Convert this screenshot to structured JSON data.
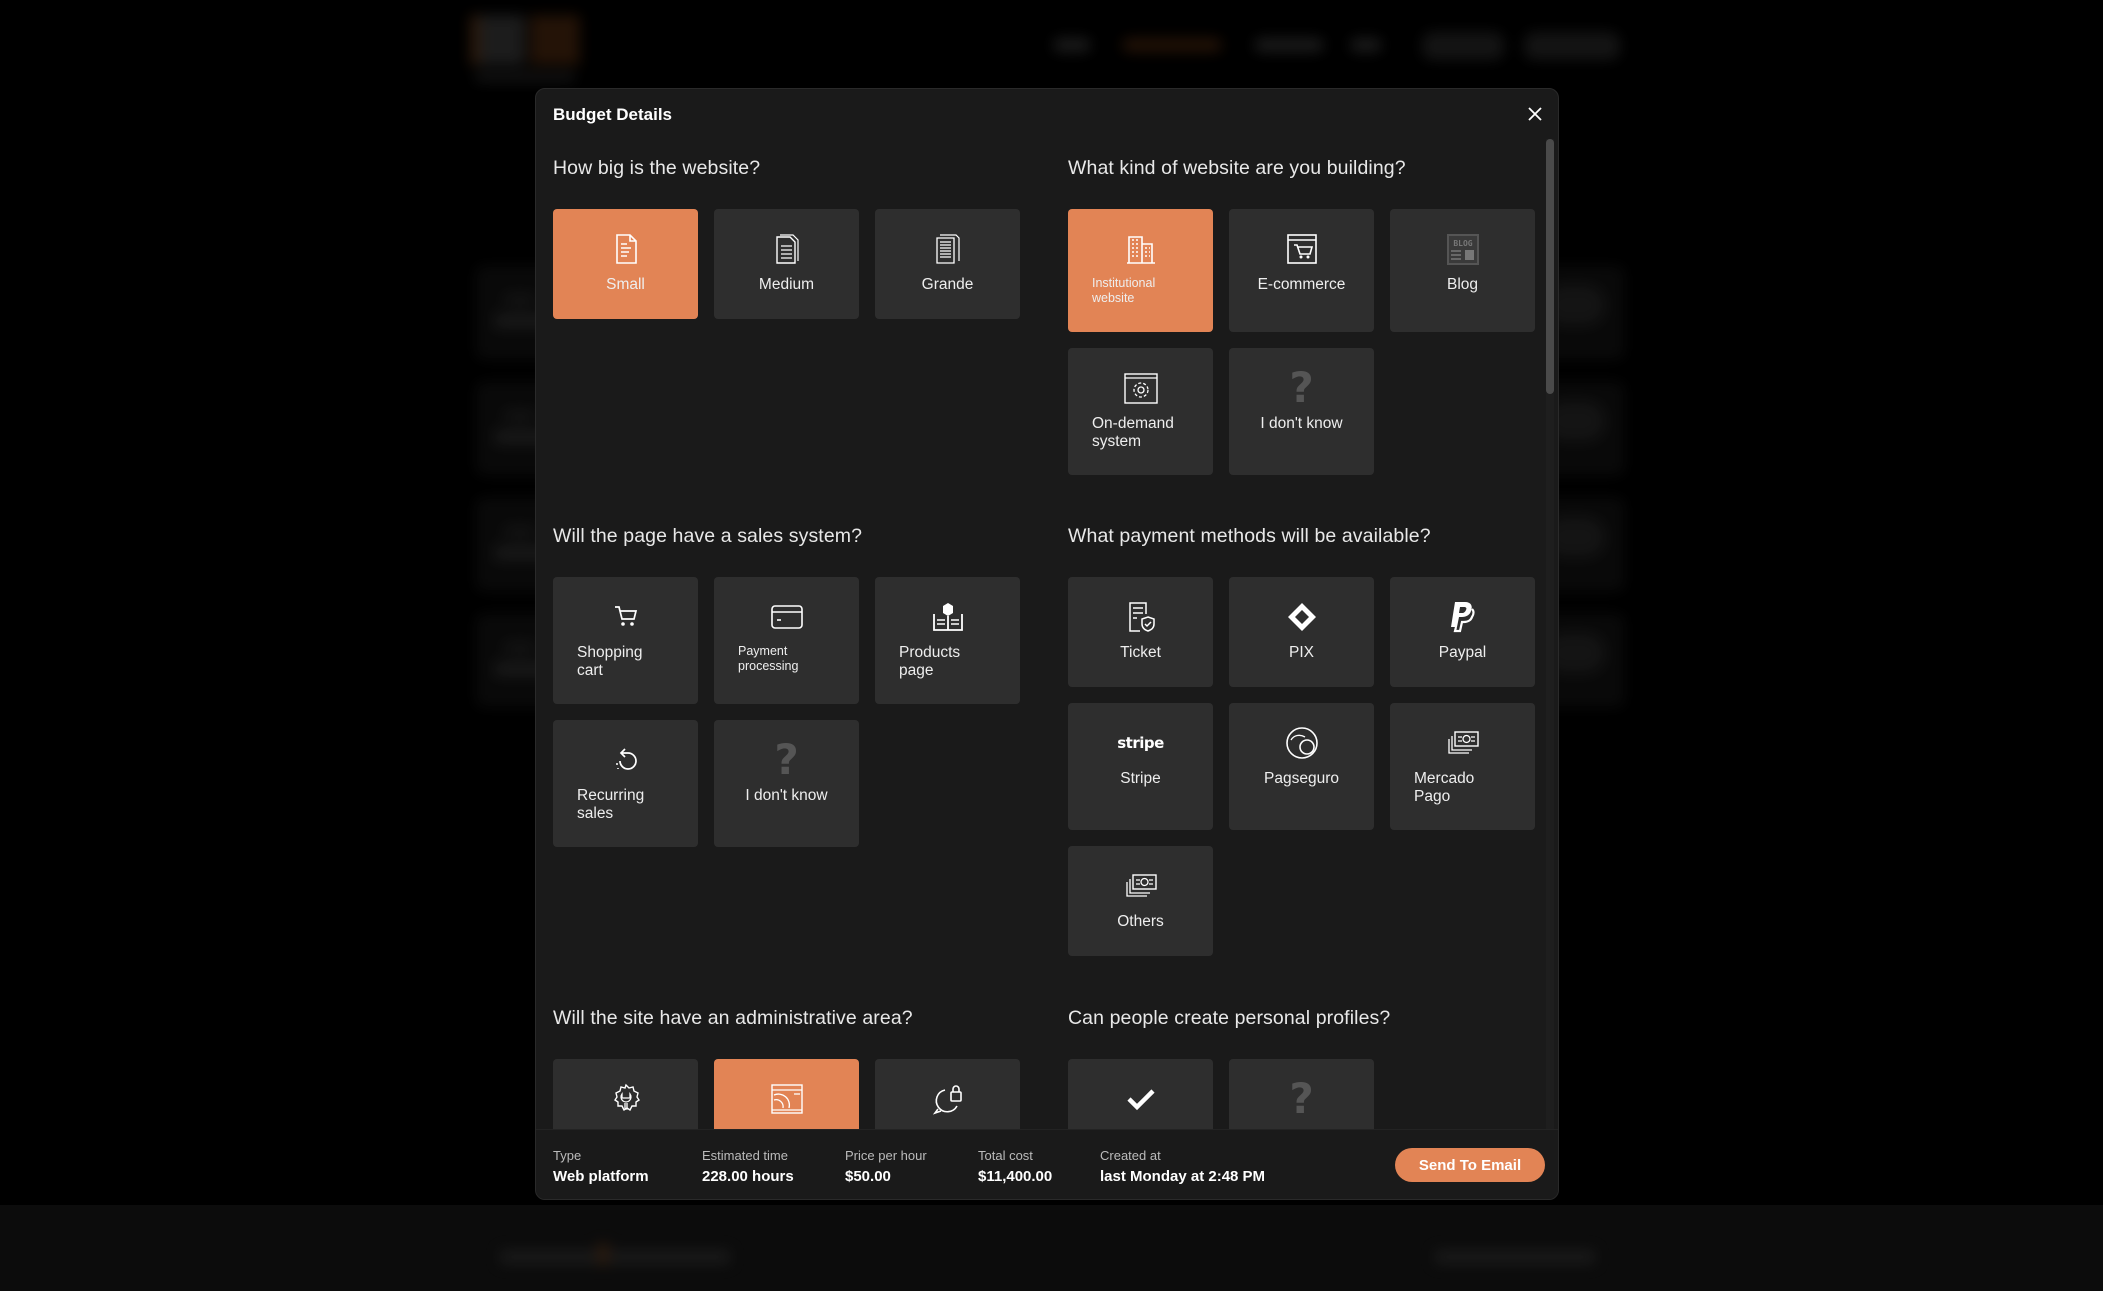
{
  "modal": {
    "title": "Budget Details",
    "close_label": "close"
  },
  "sections": {
    "size": {
      "question": "How big is the website?",
      "options": [
        {
          "label": "Small",
          "icon": "document-icon",
          "selected": true
        },
        {
          "label": "Medium",
          "icon": "documents-icon",
          "selected": false
        },
        {
          "label": "Grande",
          "icon": "document-stack-icon",
          "selected": false
        }
      ]
    },
    "kind": {
      "question": "What kind of website are you building?",
      "options": [
        {
          "label": "Institutional website",
          "icon": "building-icon",
          "selected": true
        },
        {
          "label": "E-commerce",
          "icon": "browser-cart-icon",
          "selected": false
        },
        {
          "label": "Blog",
          "icon": "blog-icon",
          "selected": false,
          "icon_text": "BLOG"
        },
        {
          "label": "On-demand system",
          "icon": "browser-gear-icon",
          "selected": false
        },
        {
          "label": "I don't know",
          "icon": "question-icon",
          "selected": false,
          "icon_text": "?"
        }
      ]
    },
    "sales": {
      "question": "Will the page have a sales system?",
      "options": [
        {
          "label": "Shopping cart",
          "icon": "cart-icon",
          "selected": false
        },
        {
          "label": "Payment processing",
          "icon": "credit-card-icon",
          "selected": false
        },
        {
          "label": "Products page",
          "icon": "product-catalog-icon",
          "selected": false
        },
        {
          "label": "Recurring sales",
          "icon": "recurring-icon",
          "selected": false
        },
        {
          "label": "I don't know",
          "icon": "question-icon",
          "selected": false,
          "icon_text": "?"
        }
      ]
    },
    "payment": {
      "question": "What payment methods will be available?",
      "options": [
        {
          "label": "Ticket",
          "icon": "ticket-shield-icon",
          "selected": false
        },
        {
          "label": "PIX",
          "icon": "pix-icon",
          "selected": false
        },
        {
          "label": "Paypal",
          "icon": "paypal-icon",
          "selected": false
        },
        {
          "label": "Stripe",
          "icon": "stripe-icon",
          "selected": false,
          "icon_text": "stripe"
        },
        {
          "label": "Pagseguro",
          "icon": "pagseguro-icon",
          "selected": false
        },
        {
          "label": "Mercado Pago",
          "icon": "banknotes-icon",
          "selected": false
        },
        {
          "label": "Others",
          "icon": "banknotes-icon",
          "selected": false
        }
      ]
    },
    "admin": {
      "question": "Will the site have an administrative area?",
      "options": [
        {
          "icon": "gear-wrench-icon",
          "selected": false
        },
        {
          "icon": "browser-admin-icon",
          "selected": true
        },
        {
          "icon": "chat-lock-icon",
          "selected": false
        }
      ]
    },
    "profiles": {
      "question": "Can people create personal profiles?",
      "options": [
        {
          "icon": "check-icon",
          "selected": false
        },
        {
          "icon": "question-icon",
          "selected": false,
          "icon_text": "?"
        }
      ]
    }
  },
  "summary": {
    "type_label": "Type",
    "type_value": "Web platform",
    "time_label": "Estimated time",
    "time_value": "228.00 hours",
    "price_label": "Price per hour",
    "price_value": "$50.00",
    "total_label": "Total cost",
    "total_value": "$11,400.00",
    "created_label": "Created at",
    "created_value": "last Monday at 2:48 PM",
    "send_label": "Send To Email"
  },
  "colors": {
    "accent": "#e28455",
    "card": "#2e2e2e",
    "modal_bg": "#1a1a1a"
  }
}
